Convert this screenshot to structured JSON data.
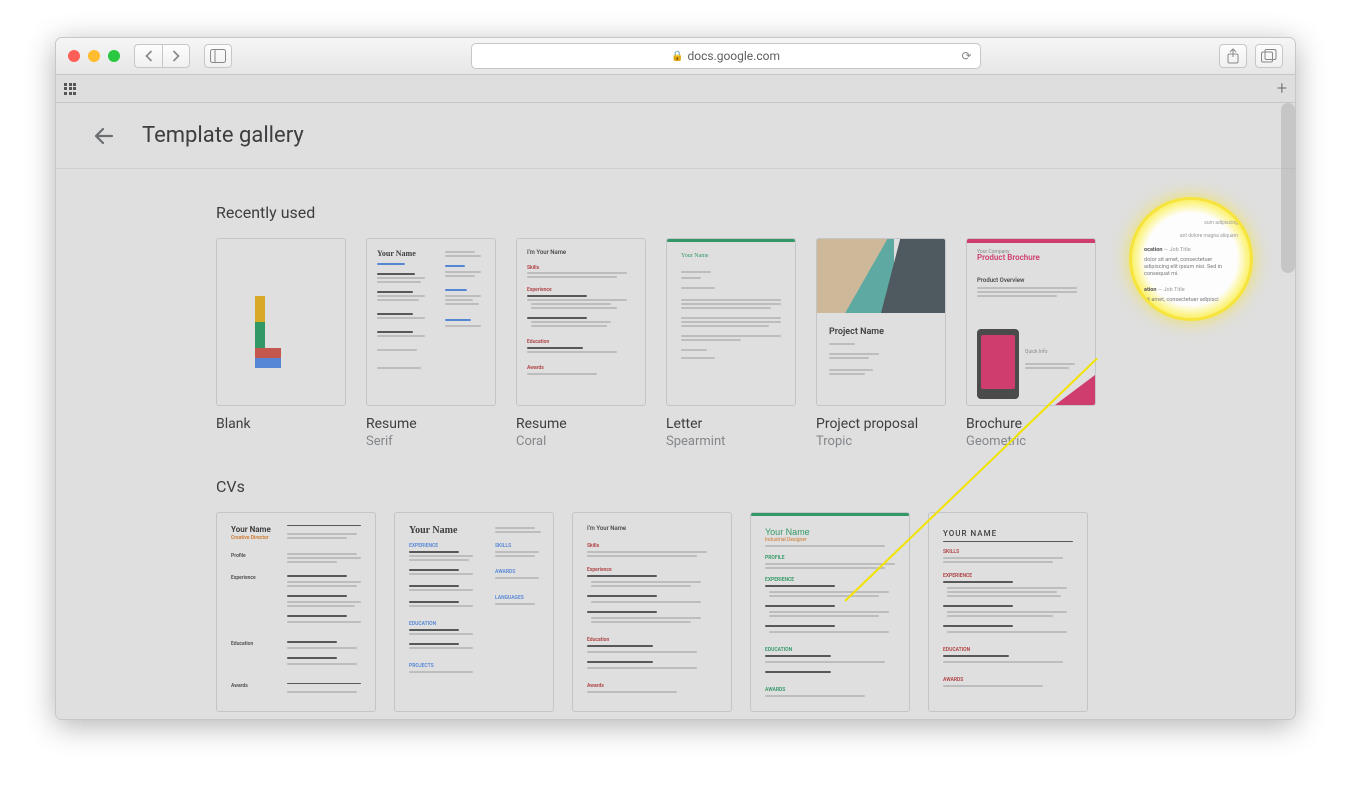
{
  "browser": {
    "url": "docs.google.com"
  },
  "gallery": {
    "title": "Template gallery",
    "sections": {
      "recently_used": {
        "heading": "Recently used",
        "items": [
          {
            "title": "Blank",
            "subtitle": ""
          },
          {
            "title": "Resume",
            "subtitle": "Serif"
          },
          {
            "title": "Resume",
            "subtitle": "Coral"
          },
          {
            "title": "Letter",
            "subtitle": "Spearmint"
          },
          {
            "title": "Project proposal",
            "subtitle": "Tropic"
          },
          {
            "title": "Brochure",
            "subtitle": "Geometric"
          }
        ]
      },
      "cvs": {
        "heading": "CVs"
      }
    }
  },
  "thumbs": {
    "serif_name": "Your Name",
    "coral_name": "Your Name",
    "coral_sub": "I'm Your Name",
    "letter_name": "Your Name",
    "proposal_name": "Project Name",
    "brochure_company": "Your Company",
    "brochure_title": "Product Brochure",
    "brochure_overview": "Product Overview",
    "cv1_name": "Your Name",
    "cv1_role": "Creative Director",
    "cv2_name": "Your Name",
    "cv4_name": "Your Name",
    "cv4_role": "Industrial Designer",
    "cv5_name": "YOUR NAME"
  },
  "magnifier": {
    "job1_loc": "Location — Job Title",
    "job1_body": "dolor sit amet, consectetuer adipiscing elit ipsum nisi. Sed in consequat mi.",
    "job2_loc": "Location — Job Title",
    "job2_body": "sit amet, consectetuer adipisci",
    "header_hint": "sum adipiscing",
    "header_hint2": "ant dolore magna aliquam"
  }
}
